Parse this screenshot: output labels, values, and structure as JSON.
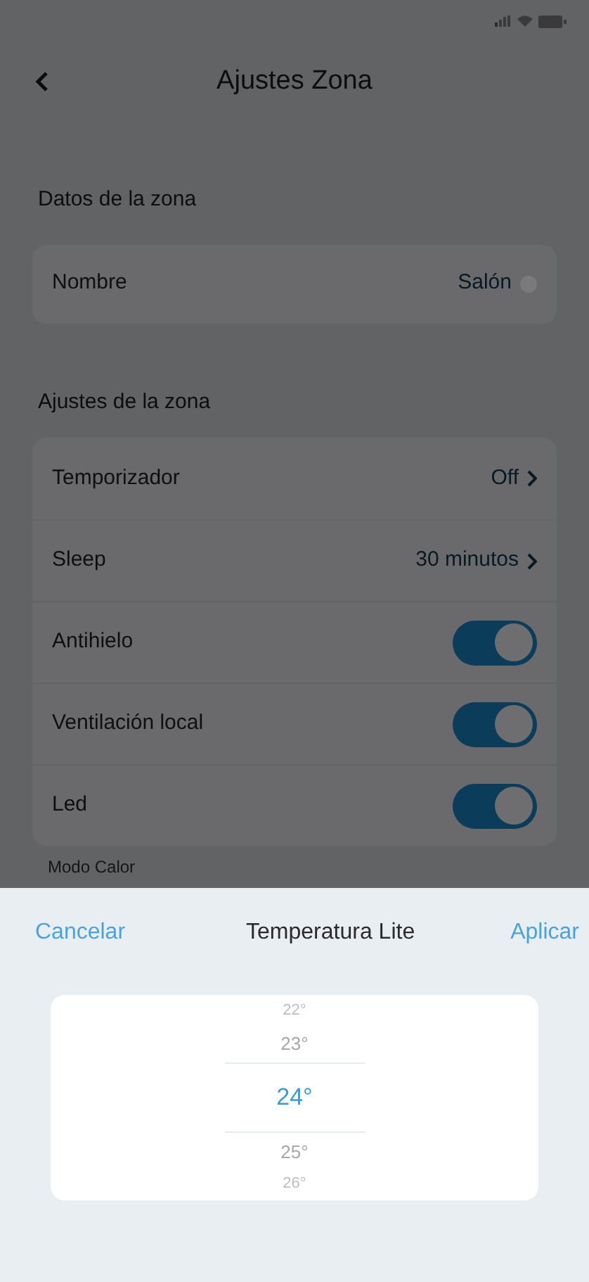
{
  "header": {
    "title": "Ajustes Zona"
  },
  "sections": [
    {
      "title": "Datos de la zona",
      "rows": [
        {
          "kind": "edit",
          "label": "Nombre",
          "value": "Salón"
        }
      ]
    },
    {
      "title": "Ajustes de la zona",
      "rows": [
        {
          "kind": "link",
          "label": "Temporizador",
          "value": "Off"
        },
        {
          "kind": "link",
          "label": "Sleep",
          "value": "30 minutos"
        },
        {
          "kind": "toggle",
          "label": "Antihielo",
          "on": true
        },
        {
          "kind": "toggle",
          "label": "Ventilación local",
          "on": true
        },
        {
          "kind": "toggle",
          "label": "Led",
          "on": true
        }
      ]
    }
  ],
  "next_section_title": "Modo Calor",
  "sheet": {
    "cancel": "Cancelar",
    "title": "Temperatura Lite",
    "apply": "Aplicar",
    "options": [
      {
        "label": "22°",
        "selected": false
      },
      {
        "label": "23°",
        "selected": false
      },
      {
        "label": "24°",
        "selected": true
      },
      {
        "label": "25°",
        "selected": false
      },
      {
        "label": "26°",
        "selected": false
      }
    ]
  }
}
